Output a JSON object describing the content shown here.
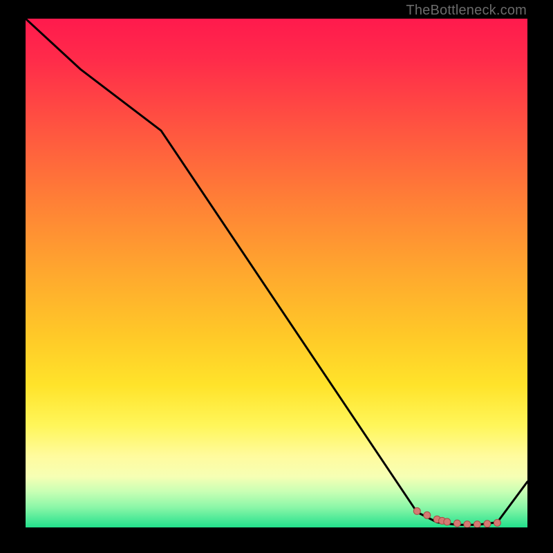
{
  "attribution": "TheBottleneck.com",
  "chart_data": {
    "type": "line",
    "title": "",
    "xlabel": "",
    "ylabel": "",
    "xlim": [
      0,
      100
    ],
    "ylim": [
      0,
      100
    ],
    "series": [
      {
        "name": "curve",
        "x": [
          0,
          11,
          27,
          78,
          82,
          86,
          90,
          94,
          100
        ],
        "y": [
          100,
          90,
          78,
          3,
          1,
          0.5,
          0.5,
          1,
          9
        ]
      }
    ],
    "markers": {
      "name": "highlight-dots",
      "x": [
        78,
        80,
        82,
        83,
        84,
        86,
        88,
        90,
        92,
        94
      ],
      "y": [
        3.2,
        2.4,
        1.6,
        1.3,
        1.1,
        0.8,
        0.6,
        0.6,
        0.7,
        0.9
      ]
    },
    "gradient_stops": [
      {
        "pos": 0,
        "color": "#ff1a4d"
      },
      {
        "pos": 50,
        "color": "#ffa82e"
      },
      {
        "pos": 80,
        "color": "#fff65a"
      },
      {
        "pos": 100,
        "color": "#22e08c"
      }
    ]
  }
}
